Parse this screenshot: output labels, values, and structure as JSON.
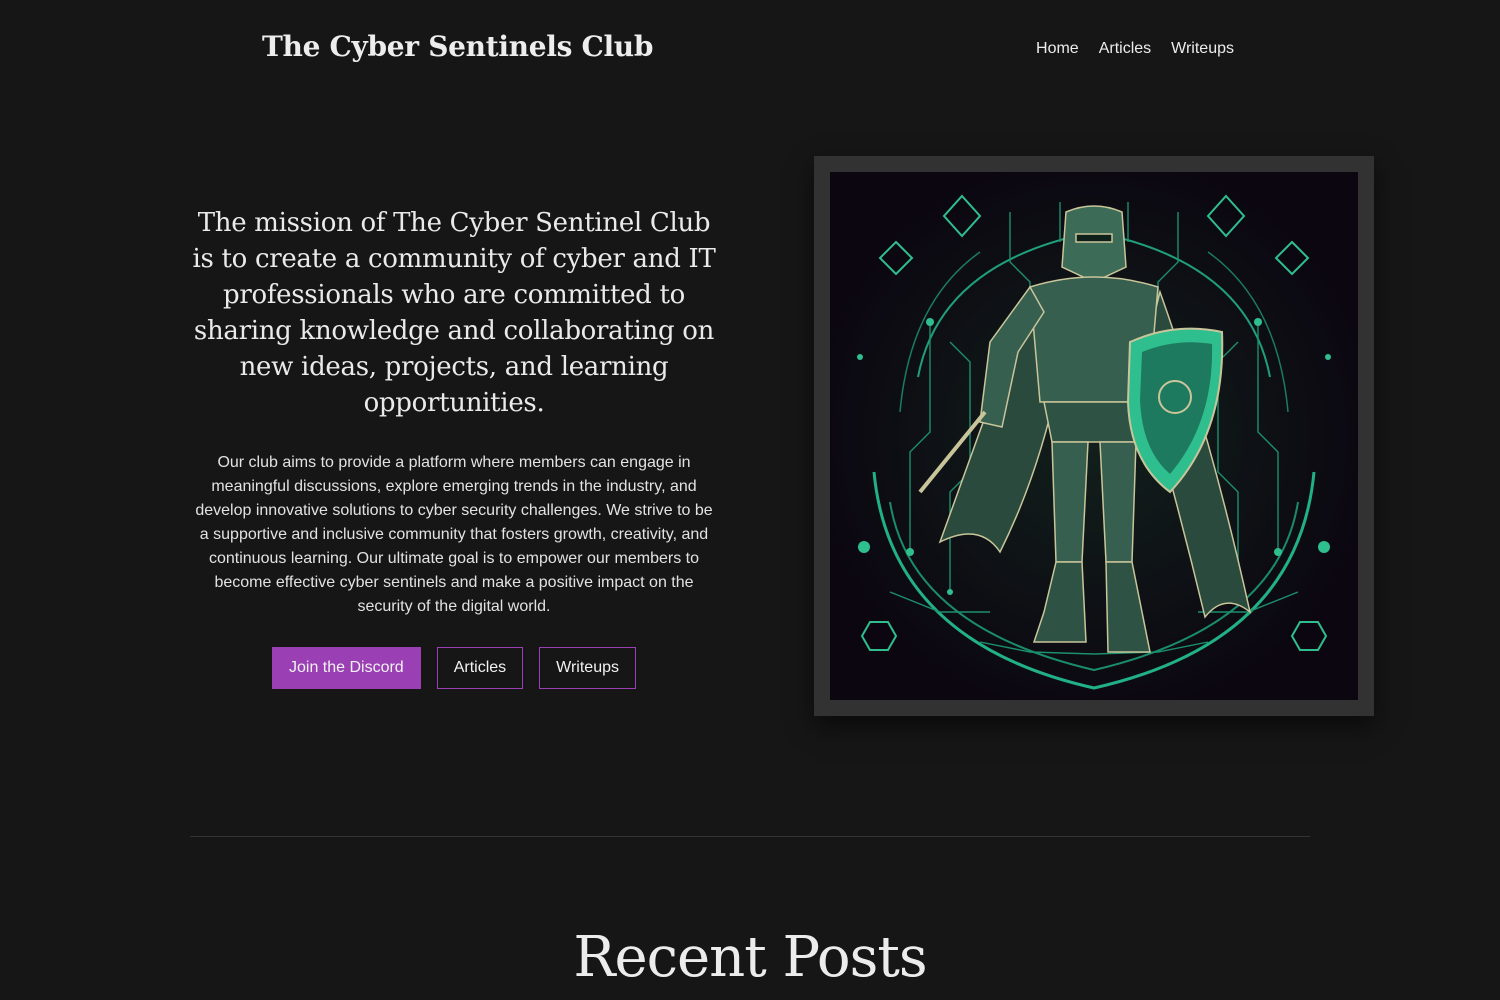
{
  "header": {
    "title": "The Cyber Sentinels Club",
    "nav": [
      {
        "label": "Home"
      },
      {
        "label": "Articles"
      },
      {
        "label": "Writeups"
      }
    ]
  },
  "hero": {
    "mission": "The mission of The Cyber Sentinel Club is to create a community of cyber and IT professionals who are committed to sharing knowledge and collaborating on new ideas, projects, and learning opportunities.",
    "description": "Our club aims to provide a platform where members can engage in meaningful discussions, explore emerging trends in the industry, and develop innovative solutions to cyber security challenges. We strive to be a supportive and inclusive community that fosters growth, creativity, and continuous learning. Our ultimate goal is to empower our members to become effective cyber sentinels and make a positive impact on the security of the digital world.",
    "buttons": {
      "discord": "Join the Discord",
      "articles": "Articles",
      "writeups": "Writeups"
    },
    "image": {
      "icon": "armored-knight-with-shield-illustration"
    }
  },
  "recent_posts": {
    "heading": "Recent Posts"
  },
  "colors": {
    "background": "#161616",
    "accent": "#9b3fb5",
    "art_green": "#2fbf8f",
    "frame": "#323232"
  }
}
